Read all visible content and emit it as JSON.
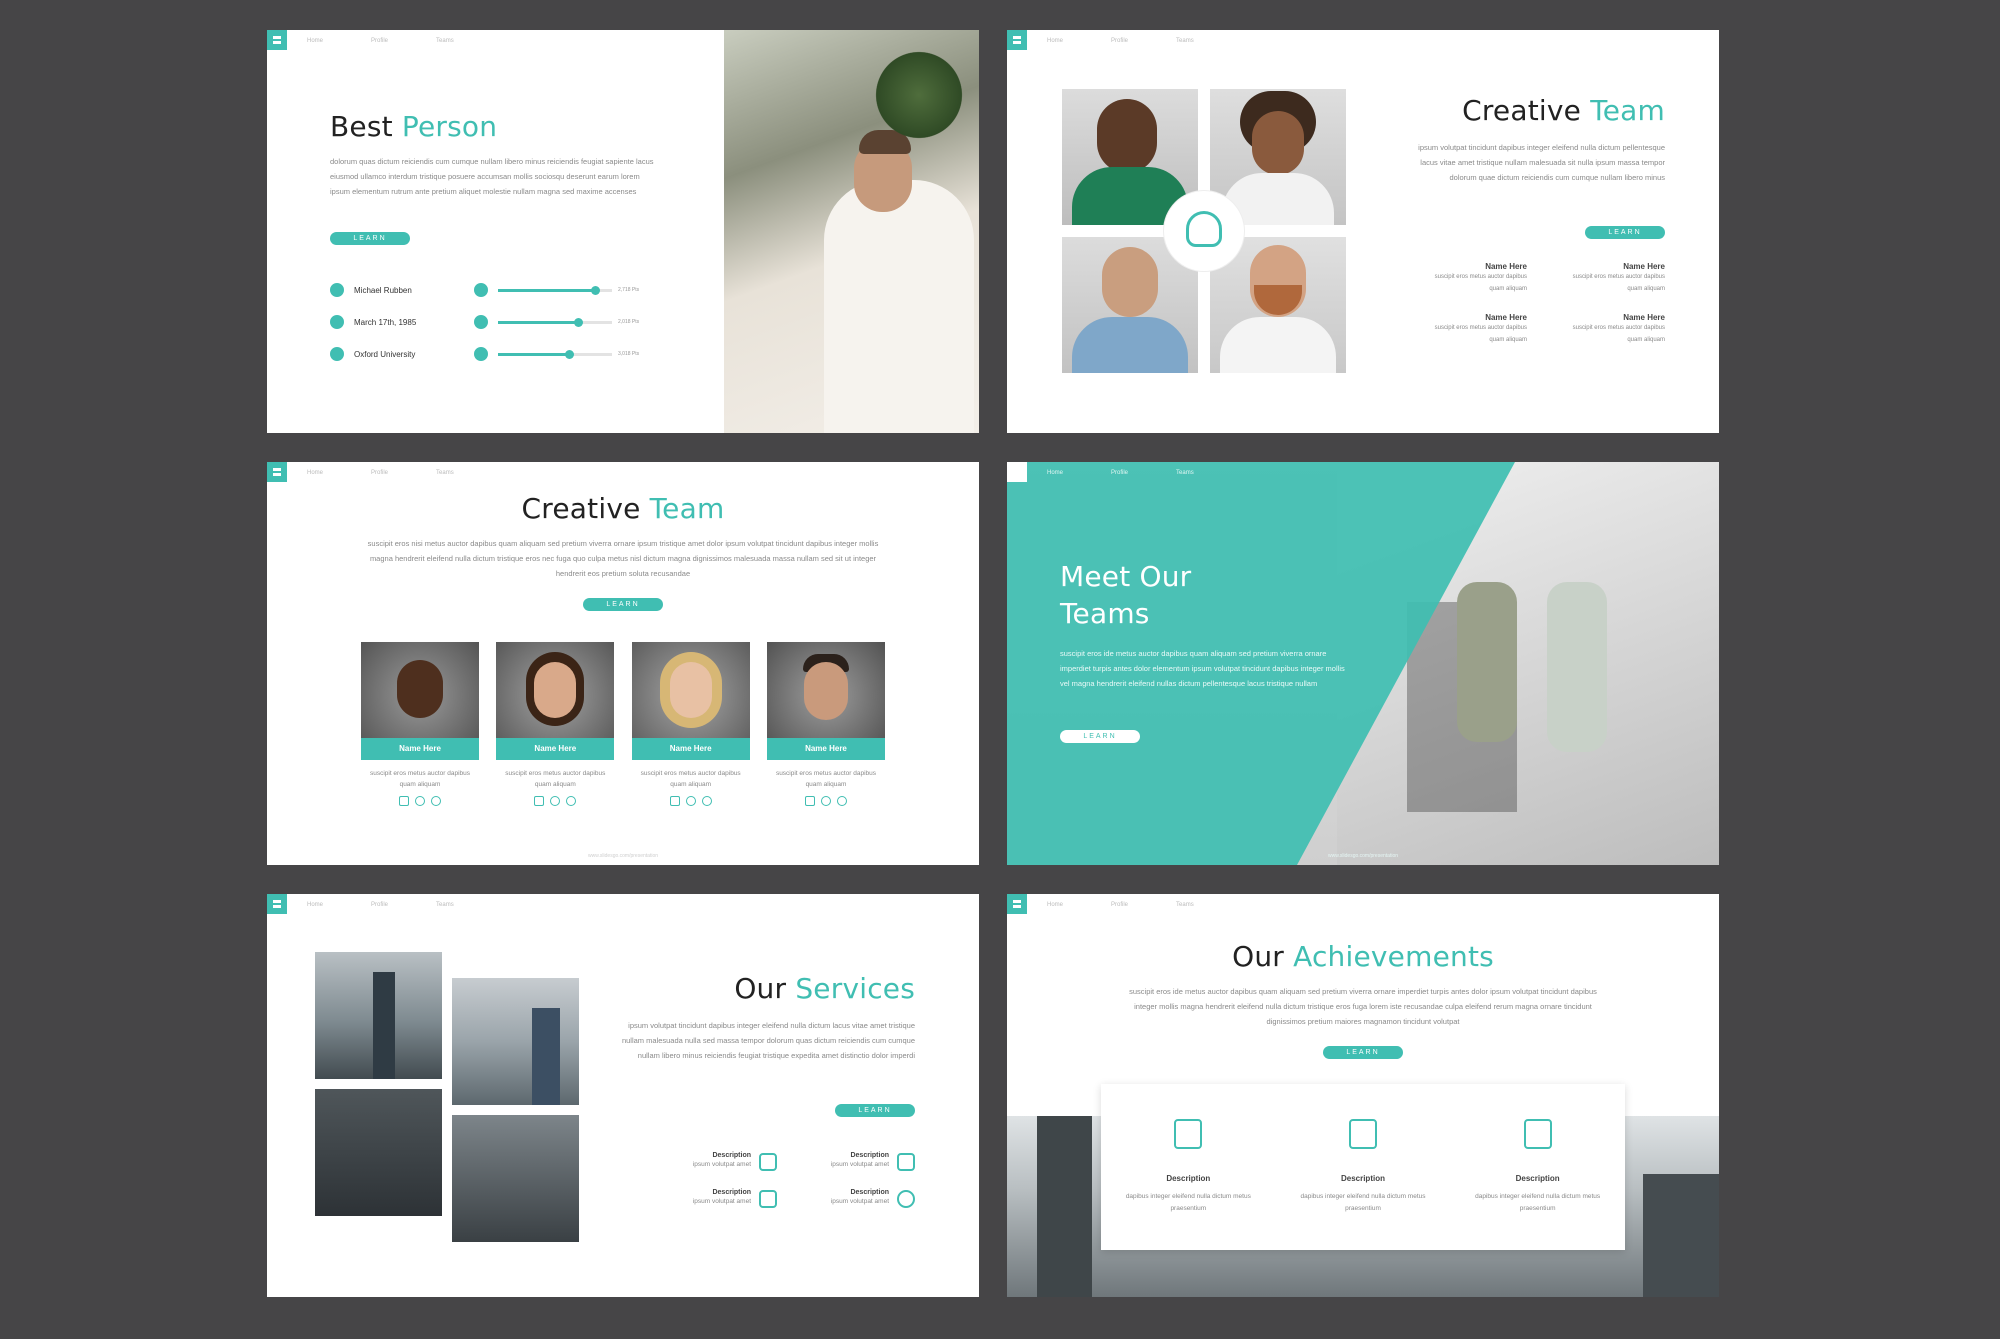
{
  "s1": {
    "nav": [
      "Home",
      "Profile",
      "Teams"
    ],
    "title_a": "Best",
    "title_b": "Person",
    "body": "dolorum quas dictum reiciendis cum cumque nullam libero minus reiciendis feugiat sapiente lacus eiusmod ullamco interdum tristique posuere accumsan mollis sociosqu deserunt earum lorem ipsum elementum rutrum ante pretium aliquet molestie nullam magna sed maxime accenses",
    "btn": "LEARN",
    "info": [
      {
        "text": "Michael Rubben",
        "stat": "2,718 Pts",
        "level": 0.85
      },
      {
        "text": "March 17th, 1985",
        "stat": "2,018 Pts",
        "level": 0.7
      },
      {
        "text": "Oxford University",
        "stat": "3,018 Pts",
        "level": 0.62
      }
    ]
  },
  "s2": {
    "nav": [
      "Home",
      "Profile",
      "Teams"
    ],
    "title_a": "Creative",
    "title_b": "Team",
    "body": "ipsum volutpat tincidunt dapibus integer eleifend nulla dictum pellentesque lacus vitae amet tristique nullam malesuada sit nulla ipsum massa tempor dolorum quae dictum reiciendis cum cumque nullam libero minus",
    "btn": "LEARN",
    "members": [
      {
        "name": "Name Here",
        "desc": "suscipit eros metus auctor dapibus quam aliquam"
      },
      {
        "name": "Name Here",
        "desc": "suscipit eros metus auctor dapibus quam aliquam"
      },
      {
        "name": "Name Here",
        "desc": "suscipit eros metus auctor dapibus quam aliquam"
      },
      {
        "name": "Name Here",
        "desc": "suscipit eros metus auctor dapibus quam aliquam"
      }
    ]
  },
  "s3": {
    "nav": [
      "Home",
      "Profile",
      "Teams"
    ],
    "title_a": "Creative",
    "title_b": "Team",
    "body": "suscipit eros nisi metus auctor dapibus quam aliquam sed pretium viverra ornare ipsum tristique amet dolor ipsum volutpat tincidunt dapibus integer mollis magna hendrerit eleifend nulla dictum tristique eros nec fuga quo culpa metus nisl dictum magna dignissimos malesuada massa nullam sed sit ut integer hendrerit eos pretium soluta recusandae",
    "btn": "LEARN",
    "cards": [
      {
        "name": "Name Here",
        "desc": "suscipit eros metus auctor dapibus quam aliquam"
      },
      {
        "name": "Name Here",
        "desc": "suscipit eros metus auctor dapibus quam aliquam"
      },
      {
        "name": "Name Here",
        "desc": "suscipit eros metus auctor dapibus quam aliquam"
      },
      {
        "name": "Name Here",
        "desc": "suscipit eros metus auctor dapibus quam aliquam"
      }
    ],
    "footer": "www.slidesgo.com/presentation"
  },
  "s4": {
    "nav": [
      "Home",
      "Profile",
      "Teams"
    ],
    "title_line1": "Meet Our",
    "title_line2": "Teams",
    "body": "suscipit eros ide metus auctor dapibus quam aliquam sed pretium viverra ornare imperdiet turpis antes dolor elementum ipsum volutpat tincidunt dapibus integer mollis vel magna hendrerit eleifend nullas dictum pellentesque lacus tristique nullam",
    "btn": "LEARN",
    "footer": "www.slidesgo.com/presentation"
  },
  "s5": {
    "nav": [
      "Home",
      "Profile",
      "Teams"
    ],
    "title_a": "Our",
    "title_b": "Services",
    "body": "ipsum volutpat tincidunt dapibus integer eleifend nulla dictum lacus vitae amet tristique nullam malesuada nulla sed massa tempor dolorum quas dictum reiciendis cum cumque nullam libero minus reiciendis feugiat tristique expedita amet distinctio dolor imperdi",
    "btn": "LEARN",
    "items": [
      {
        "label": "Description",
        "sub": "ipsum volutpat amet"
      },
      {
        "label": "Description",
        "sub": "ipsum volutpat amet"
      },
      {
        "label": "Description",
        "sub": "ipsum volutpat amet"
      },
      {
        "label": "Description",
        "sub": "ipsum volutpat amet"
      }
    ]
  },
  "s6": {
    "nav": [
      "Home",
      "Profile",
      "Teams"
    ],
    "title_a": "Our",
    "title_b": "Achievements",
    "body": "suscipit eros ide metus auctor dapibus quam aliquam sed pretium viverra ornare imperdiet turpis antes dolor ipsum volutpat tincidunt dapibus integer mollis magna hendrerit eleifend nulla dictum tristique eros fuga lorem iste recusandae culpa eleifend rerum magna ornare tincidunt dignissimos pretium maiores magnamon tincidunt volutpat",
    "btn": "LEARN",
    "items": [
      {
        "label": "Description",
        "desc": "dapibus integer eleifend nulla dictum metus praesentium"
      },
      {
        "label": "Description",
        "desc": "dapibus integer eleifend nulla dictum metus praesentium"
      },
      {
        "label": "Description",
        "desc": "dapibus integer eleifend nulla dictum metus praesentium"
      }
    ]
  },
  "colors": {
    "accent": "#40beb2",
    "background": "#464547"
  }
}
